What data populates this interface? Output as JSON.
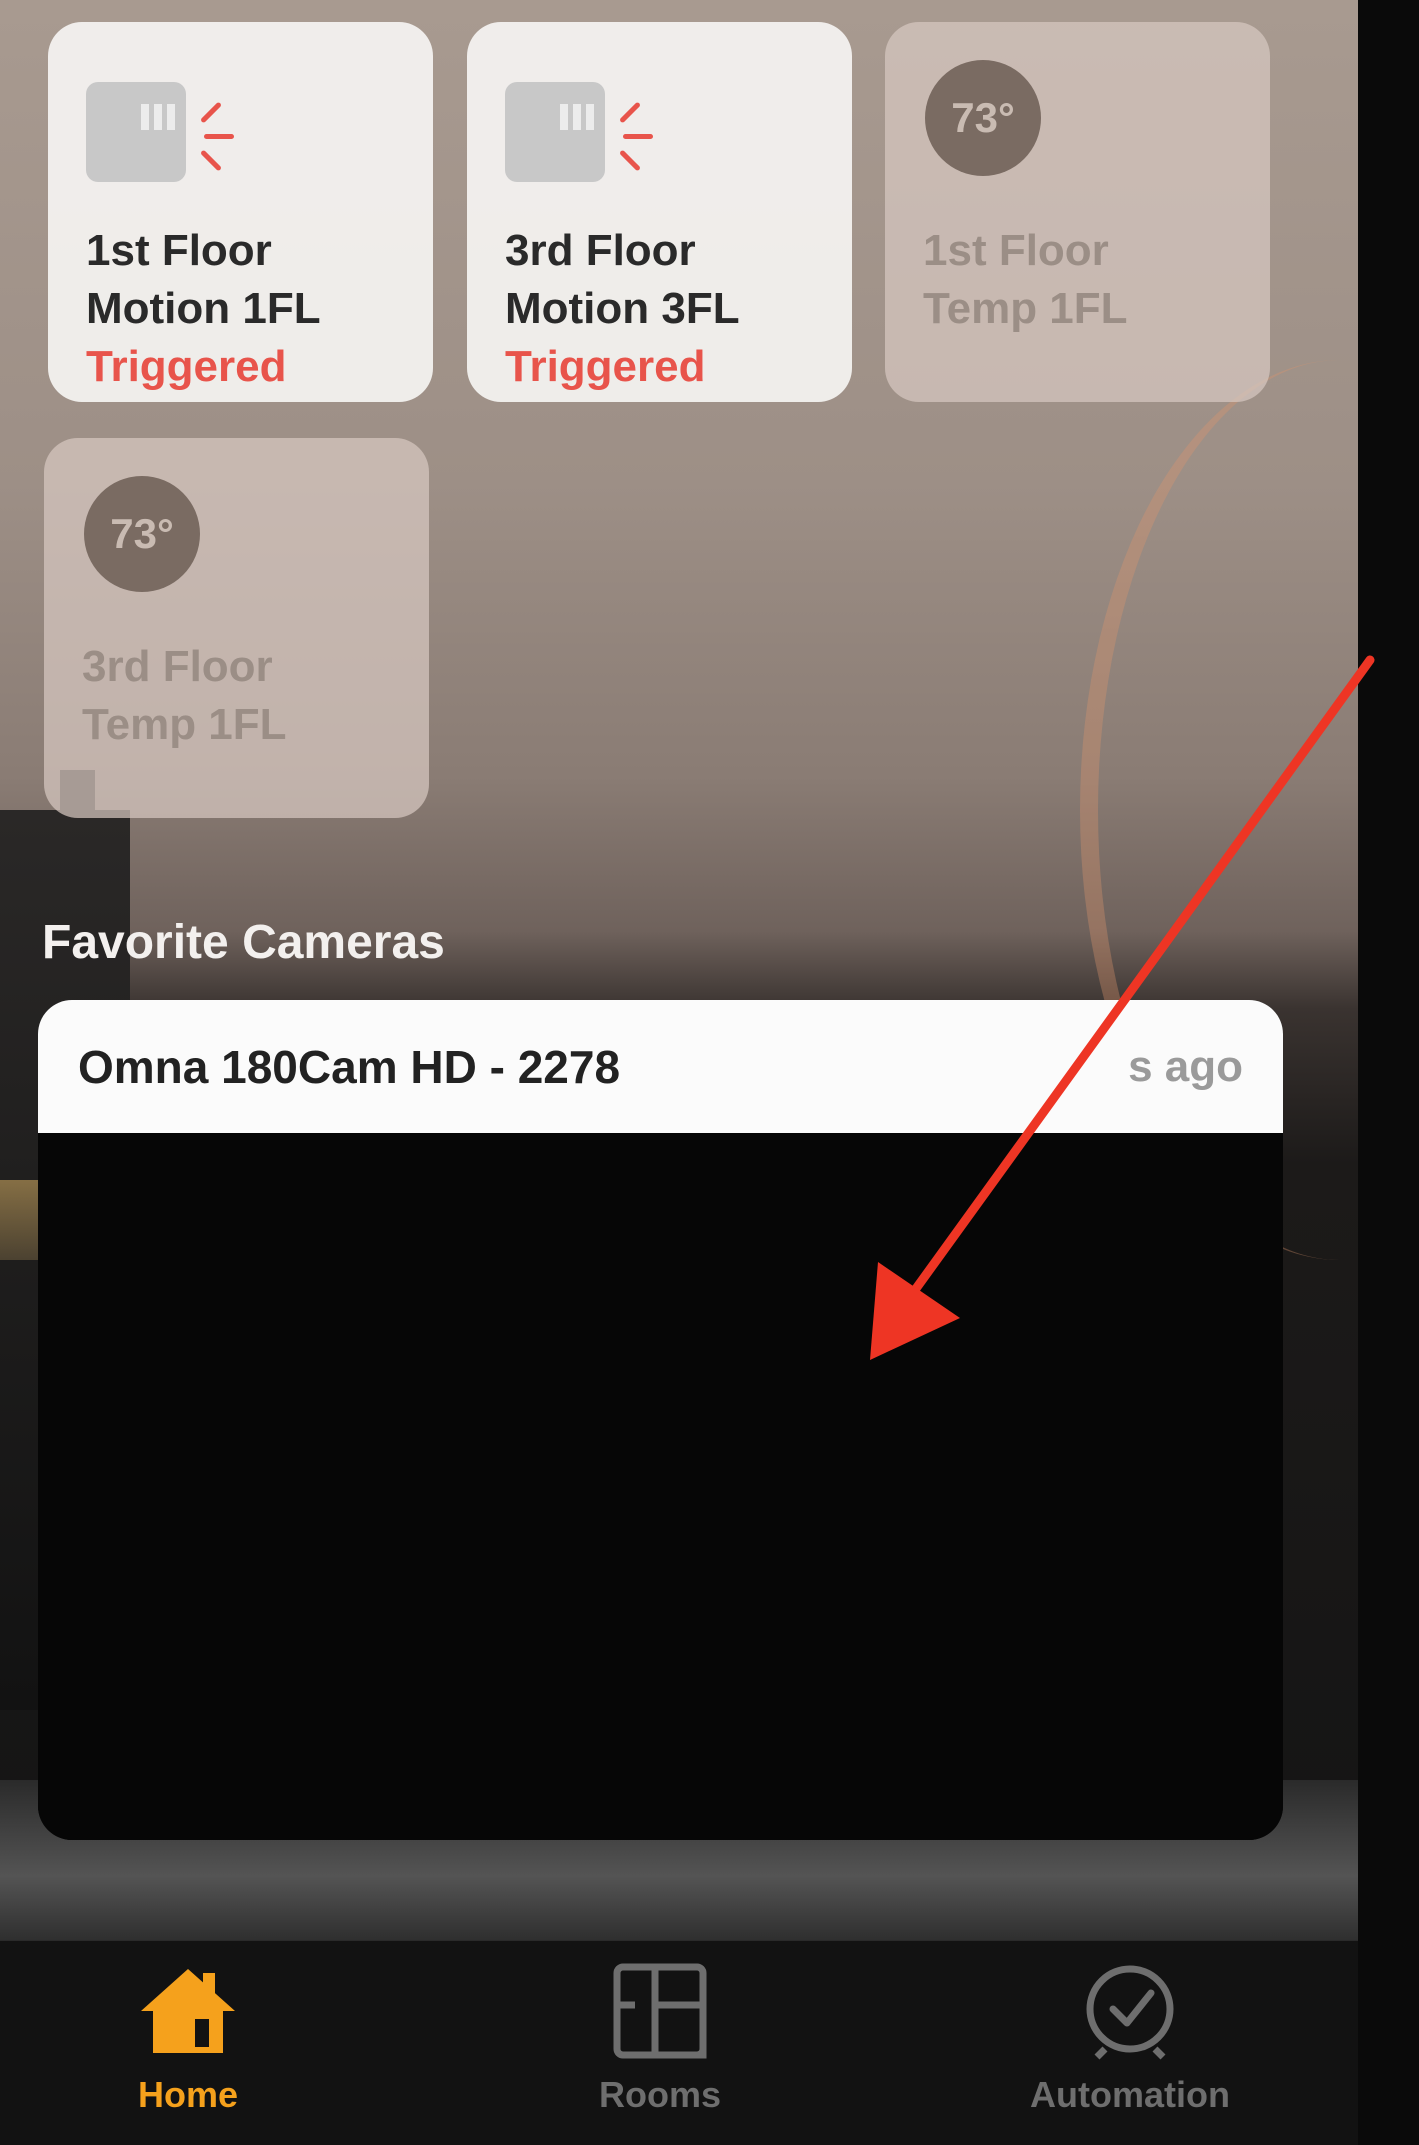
{
  "accessories": [
    {
      "room": "1st Floor",
      "name": "Motion 1FL",
      "status": "Triggered",
      "icon": "motion-sensor-icon"
    },
    {
      "room": "3rd Floor",
      "name": "Motion 3FL",
      "status": "Triggered",
      "icon": "motion-sensor-icon"
    },
    {
      "room": "1st Floor",
      "name": "Temp 1FL",
      "value": "73°",
      "icon": "temperature-sensor-icon"
    },
    {
      "room": "3rd Floor",
      "name": "Temp 1FL",
      "value": "73°",
      "icon": "temperature-sensor-icon"
    }
  ],
  "cameras": {
    "section_title": "Favorite Cameras",
    "items": [
      {
        "name": "Omna 180Cam HD - 2278",
        "updated": "s ago"
      }
    ]
  },
  "tabbar": {
    "items": [
      {
        "label": "Home",
        "icon": "house-icon",
        "selected": true
      },
      {
        "label": "Rooms",
        "icon": "rooms-icon",
        "selected": false
      },
      {
        "label": "Automation",
        "icon": "clock-check-icon",
        "selected": false
      }
    ],
    "accent": "#f5a11c"
  },
  "colors": {
    "triggered": "#e8544b",
    "annotation_arrow": "#ee3524"
  }
}
